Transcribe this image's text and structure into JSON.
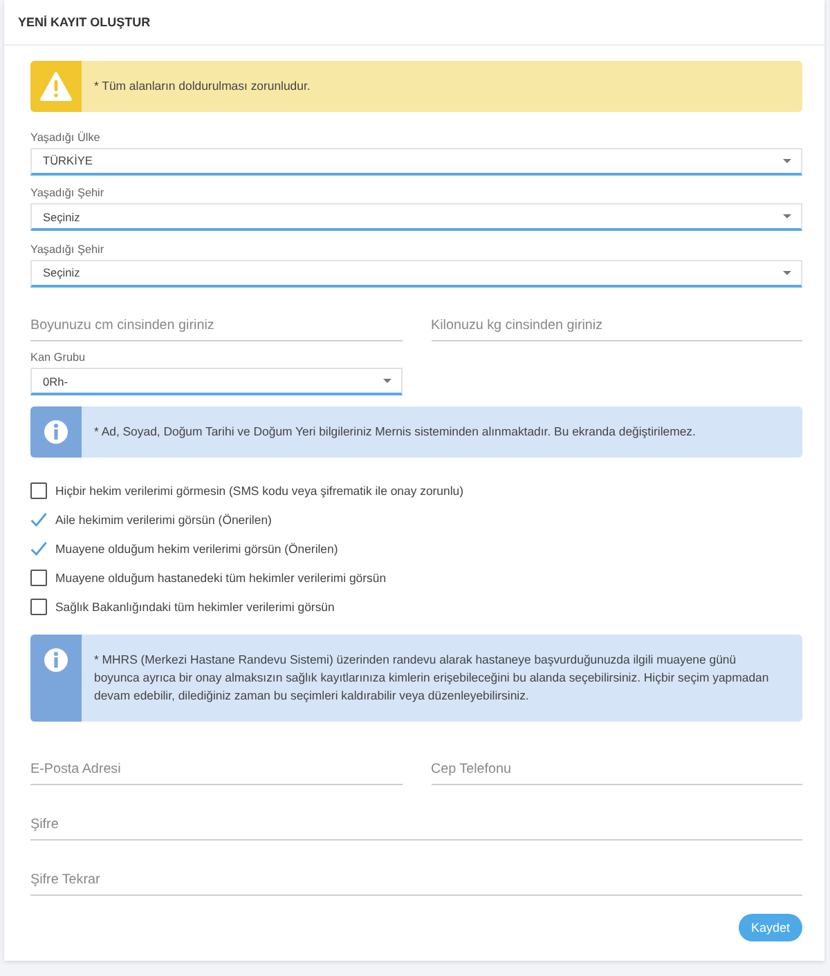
{
  "title": "YENİ KAYIT OLUŞTUR",
  "items": [
    {
      "kind": "warning",
      "text": "* Tüm alanların doldurulması zorunludur."
    },
    {
      "kind": "select",
      "label": "Yaşadığı Ülke",
      "value": "TÜRKİYE"
    },
    {
      "kind": "select",
      "label": "Yaşadığı Şehir",
      "value": "Seçiniz"
    },
    {
      "kind": "select",
      "label": "Yaşadığı Şehir",
      "value": "Seçiniz"
    },
    {
      "kind": "row",
      "fields": [
        {
          "kind": "input",
          "placeholder": "Boyunuzu cm cinsinden giriniz"
        },
        {
          "kind": "input",
          "placeholder": "Kilonuzu kg cinsinden giriniz"
        }
      ]
    },
    {
      "kind": "row",
      "fields": [
        {
          "kind": "select",
          "label": "Kan Grubu",
          "value": "0Rh-"
        }
      ]
    },
    {
      "kind": "info",
      "text": "* Ad, Soyad, Doğum Tarihi ve Doğum Yeri bilgileriniz Mernis sisteminden alınmaktadır. Bu ekranda değiştirilemez."
    },
    {
      "kind": "checkbox",
      "label": "Hiçbir hekim verilerimi görmesin (SMS kodu veya şifrematik ile onay zorunlu)",
      "checked": false
    },
    {
      "kind": "checkbox",
      "label": "Aile hekimim verilerimi görsün (Önerilen)",
      "checked": true
    },
    {
      "kind": "checkbox",
      "label": "Muayene olduğum hekim verilerimi görsün (Önerilen)",
      "checked": true
    },
    {
      "kind": "checkbox",
      "label": "Muayene olduğum hastanedeki tüm hekimler verilerimi görsün",
      "checked": false
    },
    {
      "kind": "checkbox",
      "label": "Sağlık Bakanlığındaki tüm hekimler verilerimi görsün",
      "checked": false
    },
    {
      "kind": "info",
      "text": "* MHRS (Merkezi Hastane Randevu Sistemi) üzerinden randevu alarak hastaneye başvurduğunuzda ilgili muayene günü boyunca ayrıca bir onay almaksızın sağlık kayıtlarınıza kimlerin erişebileceğini bu alanda seçebilirsiniz. Hiçbir seçim yapmadan devam edebilir, dilediğiniz zaman bu seçimleri kaldırabilir veya düzenleyebilirsiniz."
    },
    {
      "kind": "row",
      "fields": [
        {
          "kind": "input",
          "placeholder": "E-Posta Adresi"
        },
        {
          "kind": "input",
          "placeholder": "Cep Telefonu"
        }
      ]
    },
    {
      "kind": "input",
      "placeholder": "Şifre"
    },
    {
      "kind": "input",
      "placeholder": "Şifre Tekrar"
    }
  ],
  "submit": "Kaydet"
}
